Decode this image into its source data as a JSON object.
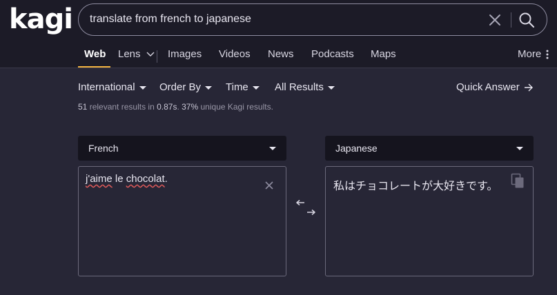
{
  "logo": "kagi",
  "search": {
    "query": "translate from french to japanese",
    "clear_icon": "close-icon",
    "submit_icon": "search-icon"
  },
  "tabs": [
    {
      "label": "Web",
      "active": true
    },
    {
      "label": "Lens"
    },
    {
      "label": "Images"
    },
    {
      "label": "Videos"
    },
    {
      "label": "News"
    },
    {
      "label": "Podcasts"
    },
    {
      "label": "Maps"
    }
  ],
  "more_label": "More",
  "filters": {
    "region": "International",
    "order": "Order By",
    "time": "Time",
    "results": "All Results",
    "quick_answer": "Quick Answer"
  },
  "stats": {
    "count": "51",
    "count_text": "relevant results in",
    "time": "0.87s",
    "unique_pct": "37%",
    "unique_text": "unique Kagi results."
  },
  "translator": {
    "source_lang": "French",
    "target_lang": "Japanese",
    "source_words": [
      "j'aime",
      "le",
      "chocolat",
      "."
    ],
    "target_text": "私はチョコレートが大好きです。"
  },
  "colors": {
    "background": "#272636",
    "topbar": "#1c1b27",
    "accent": "#f3b440",
    "spellcheck": "#e05b5b"
  }
}
